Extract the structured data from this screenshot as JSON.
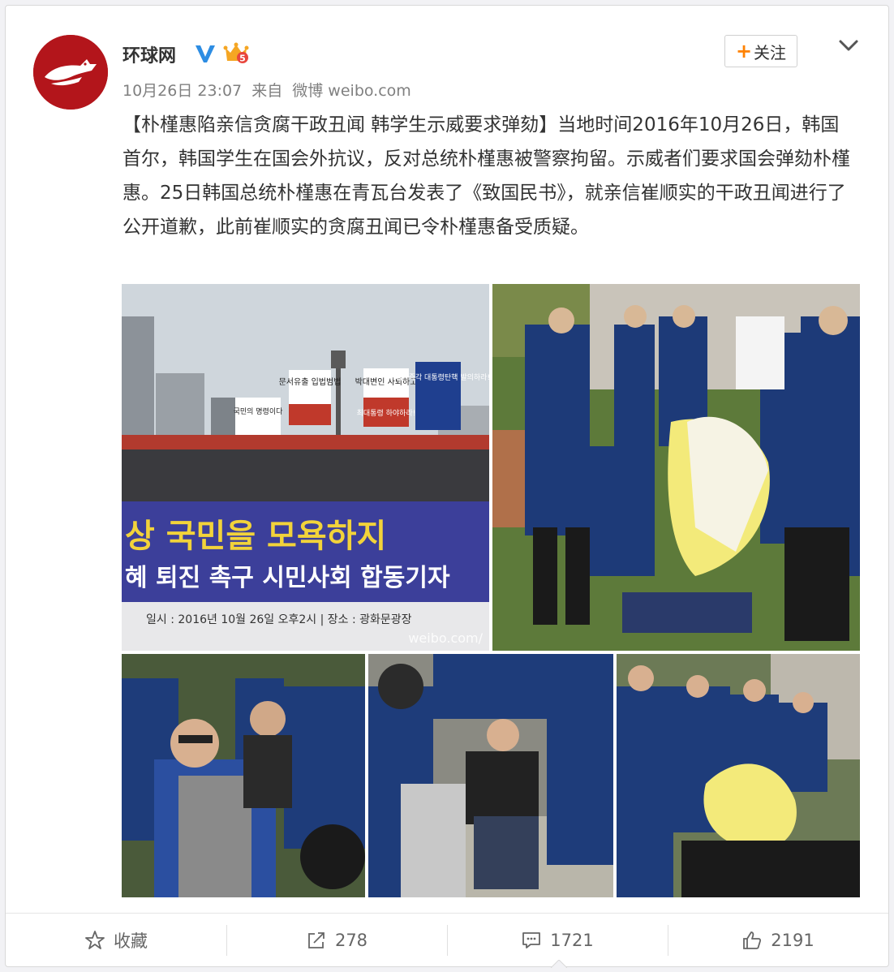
{
  "post": {
    "author": "环球网",
    "verified_icon": "verified-v-icon",
    "badge_icon": "crown-level-icon",
    "timestamp": "10月26日 23:07",
    "source_prefix": "来自",
    "source": "微博 weibo.com",
    "follow_label": "关注",
    "text": "【朴槿惠陷亲信贪腐干政丑闻 韩学生示威要求弹劾】当地时间2016年10月26日，韩国首尔，韩国学生在国会外抗议，反对总统朴槿惠被警察拘留。示威者们要求国会弹劾朴槿惠。25日韩国总统朴槿惠在青瓦台发表了《致国民书》，就亲信崔顺实的干政丑闻进行了公开道歉，此前崔顺实的贪腐丑闻已令朴槿惠备受质疑。",
    "watermark": "weibo.com/"
  },
  "photos": {
    "banner_line1": "상 국민을 모욕하지",
    "banner_line2": "혜 퇴진 촉구 시민사회 합동기자",
    "banner_line3": "일시 : 2016년 10월 26일 오후2시  |  장소 : 광화문광장",
    "signs": [
      "문서유출 입법범법",
      "박대변인 사퇴하고",
      "국회는 즉각 대통령탄핵 발의하라!",
      "국민의 명령이다",
      "최대통령 하야하라!"
    ]
  },
  "actions": {
    "favorite_label": "收藏",
    "repost_count": "278",
    "comment_count": "1721",
    "like_count": "2191"
  },
  "colors": {
    "accent_orange": "#ff8200",
    "avatar_red": "#b3151b",
    "verified_blue": "#2d8de3"
  }
}
